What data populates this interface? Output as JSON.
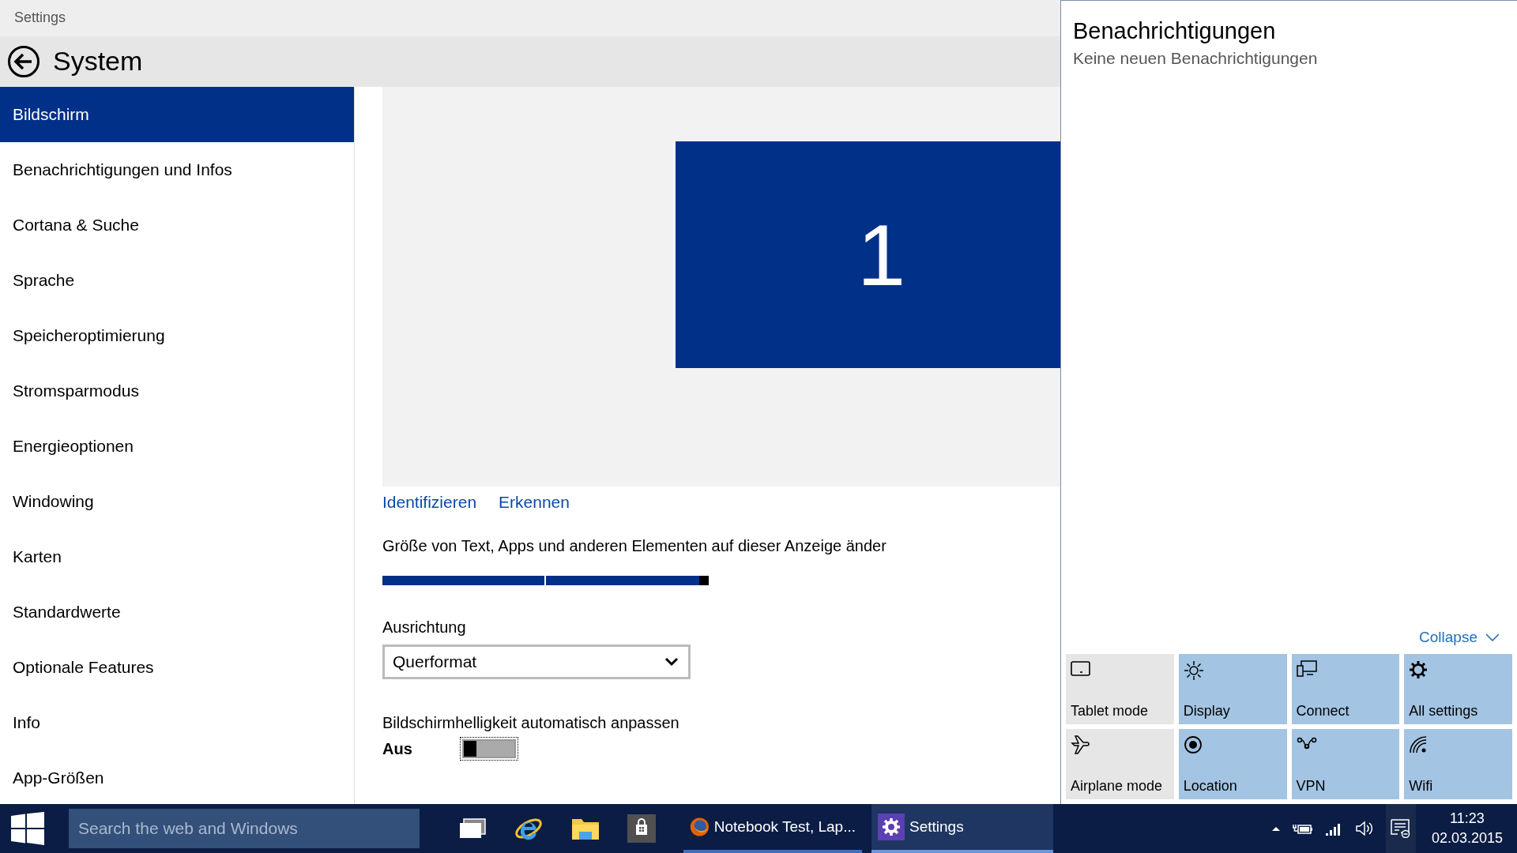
{
  "window": {
    "title": "Settings"
  },
  "header": {
    "title": "System"
  },
  "sidebar": {
    "items": [
      {
        "label": "Bildschirm",
        "selected": true
      },
      {
        "label": "Benachrichtigungen und Infos",
        "selected": false
      },
      {
        "label": "Cortana & Suche",
        "selected": false
      },
      {
        "label": "Sprache",
        "selected": false
      },
      {
        "label": "Speicheroptimierung",
        "selected": false
      },
      {
        "label": "Stromsparmodus",
        "selected": false
      },
      {
        "label": "Energieoptionen",
        "selected": false
      },
      {
        "label": "Windowing",
        "selected": false
      },
      {
        "label": "Karten",
        "selected": false
      },
      {
        "label": "Standardwerte",
        "selected": false
      },
      {
        "label": "Optionale Features",
        "selected": false
      },
      {
        "label": "Info",
        "selected": false
      },
      {
        "label": "App-Größen",
        "selected": false
      }
    ]
  },
  "display": {
    "monitor_number": "1",
    "links": [
      "Identifizieren",
      "Erkennen"
    ],
    "scale": {
      "label": "Größe von Text, Apps und anderen Elementen auf dieser Anzeige änder",
      "level": 1
    },
    "orientation": {
      "label": "Ausrichtung",
      "value": "Querformat"
    },
    "auto_brightness": {
      "label": "Bildschirmhelligkeit automatisch anpassen",
      "state_text": "Aus",
      "on": false
    }
  },
  "notifications": {
    "title": "Benachrichtigungen",
    "subtitle": "Keine neuen Benachrichtigungen",
    "collapse": "Collapse",
    "quick_actions": [
      {
        "label": "Tablet mode",
        "kind": "tablet",
        "on": false
      },
      {
        "label": "Display",
        "kind": "display",
        "on": true
      },
      {
        "label": "Connect",
        "kind": "connect",
        "on": true
      },
      {
        "label": "All settings",
        "kind": "settings",
        "on": true
      },
      {
        "label": "Airplane mode",
        "kind": "airplane",
        "on": false
      },
      {
        "label": "Location",
        "kind": "location",
        "on": true
      },
      {
        "label": "VPN",
        "kind": "vpn",
        "on": true
      },
      {
        "label": "Wifi",
        "kind": "wifi",
        "on": true
      }
    ]
  },
  "taskbar": {
    "search": {
      "placeholder": "Search the web and Windows"
    },
    "apps": [
      {
        "label": "Notebook Test, Lap...",
        "kind": "firefox",
        "selected": false
      },
      {
        "label": "Settings",
        "kind": "settings",
        "selected": true
      }
    ],
    "clock": {
      "time": "11:23",
      "date": "02.03.2015"
    }
  }
}
